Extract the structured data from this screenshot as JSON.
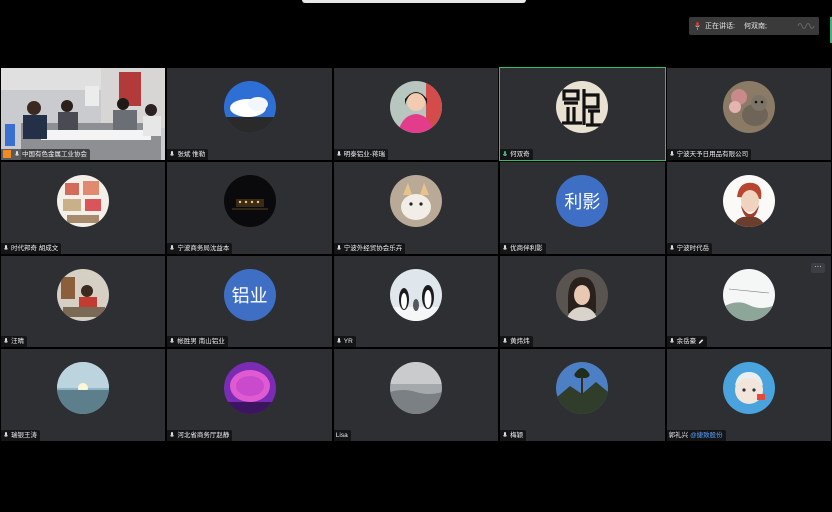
{
  "speaking": {
    "label": "正在讲话:",
    "name": "何双南;"
  },
  "tiles": [
    {
      "name": "中国有色金属工业协会",
      "host": true
    },
    {
      "name": "张斌 惟勒"
    },
    {
      "name": "明泰铝业-蒋瑞"
    },
    {
      "name": "何双奇",
      "active": true
    },
    {
      "name": "宁波天予日用品有限公司"
    },
    {
      "name": "时代邦奇 胡成文"
    },
    {
      "name": "宁波商务局沈益本"
    },
    {
      "name": "宁波外经贸协会乐卉"
    },
    {
      "name": "优商伴利影",
      "avatar_text": "利影"
    },
    {
      "name": "宁波时代岳"
    },
    {
      "name": "汪晴"
    },
    {
      "name": "帐胜男 南山铝业",
      "avatar_text": "铝业"
    },
    {
      "name": "YR"
    },
    {
      "name": "黄炜炜"
    },
    {
      "name": "余岳豪"
    },
    {
      "name": "瑞银王涛"
    },
    {
      "name": "河北省商务厅赵静"
    },
    {
      "name": "Lisa"
    },
    {
      "name": "梅颖"
    },
    {
      "name": "郭礼兴",
      "suffix": "@捷致股份"
    }
  ],
  "more_label": "···",
  "colors": {
    "active_border": "#2fbf6a",
    "tile_bg": "#2e2f33",
    "text_avatar": "#3e6fc4",
    "host_badge": "#f28a1d"
  }
}
